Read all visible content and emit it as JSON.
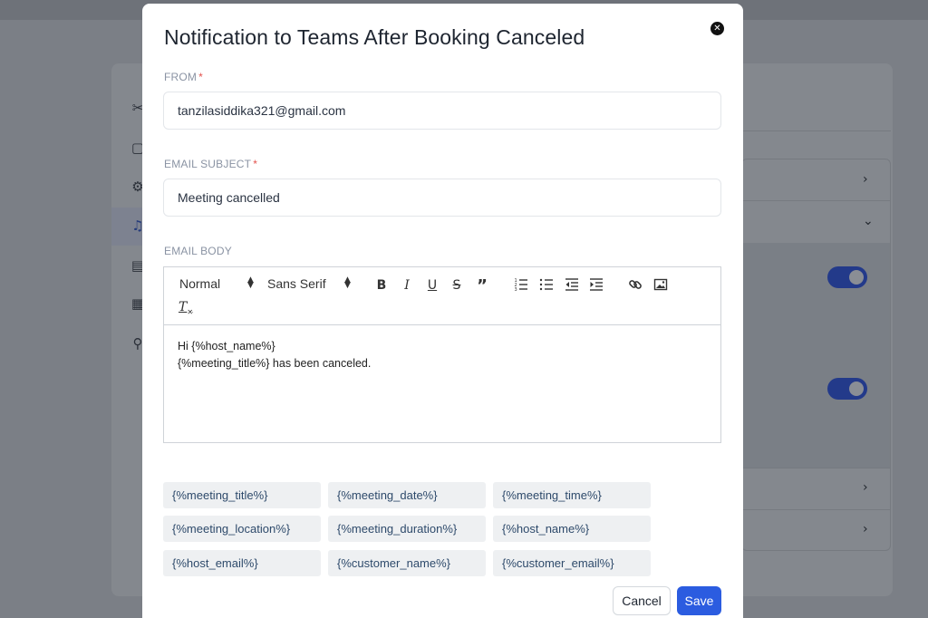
{
  "modal": {
    "title": "Notification to Teams After Booking Canceled",
    "close_icon": "close-icon"
  },
  "from": {
    "label": "FROM",
    "required_mark": "*",
    "value": "tanzilasiddika321@gmail.com"
  },
  "subject": {
    "label": "EMAIL SUBJECT",
    "required_mark": "*",
    "value": "Meeting cancelled"
  },
  "body": {
    "label": "EMAIL BODY",
    "toolbar": {
      "heading_select": "Normal",
      "font_select": "Sans Serif",
      "bold": "B",
      "italic": "I",
      "underline": "U",
      "strike": "S",
      "quote": "”",
      "clean": "T"
    },
    "lines": [
      "Hi {%host_name%}",
      "{%meeting_title%} has been canceled."
    ]
  },
  "tags": [
    "{%meeting_title%}",
    "{%meeting_date%}",
    "{%meeting_time%}",
    "{%meeting_location%}",
    "{%meeting_duration%}",
    "{%host_name%}",
    "{%host_email%}",
    "{%customer_name%}",
    "{%customer_email%}"
  ],
  "actions": {
    "cancel": "Cancel",
    "save": "Save"
  },
  "colors": {
    "primary": "#2b5ce0",
    "required": "#e3524d",
    "tag_bg": "#eef0f2",
    "tag_text": "#2e4a6b",
    "overlay": "#7b7f86"
  }
}
